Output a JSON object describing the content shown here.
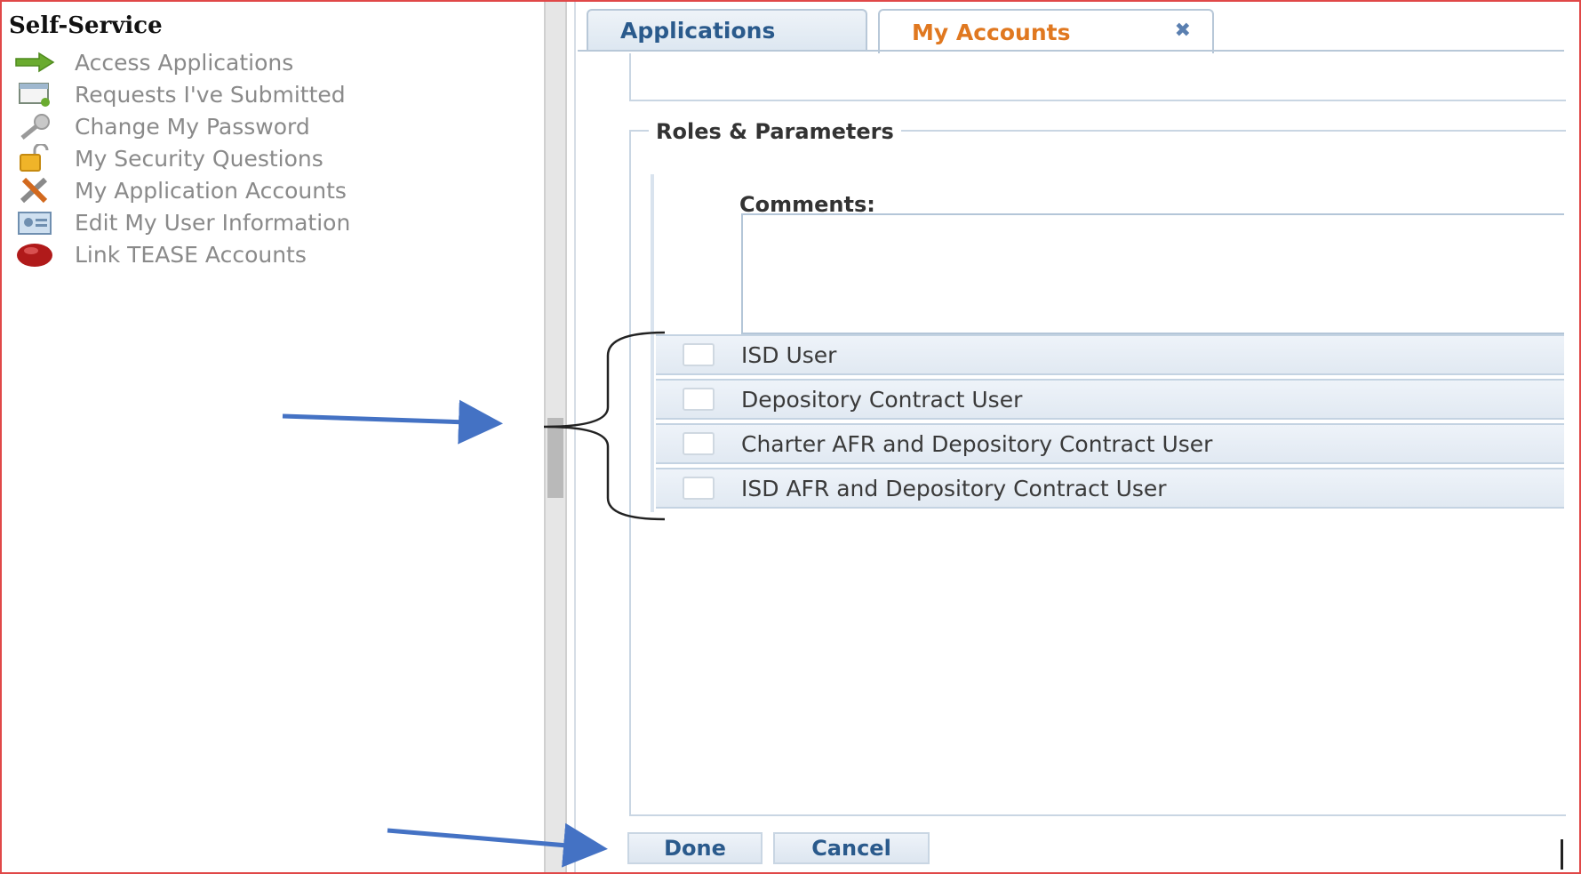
{
  "sidebar": {
    "title": "Self-Service",
    "items": [
      {
        "label": "Access Applications",
        "icon": "green-arrow-icon"
      },
      {
        "label": "Requests I've Submitted",
        "icon": "requests-icon"
      },
      {
        "label": "Change My Password",
        "icon": "key-icon"
      },
      {
        "label": "My Security Questions",
        "icon": "padlock-icon"
      },
      {
        "label": "My Application Accounts",
        "icon": "tools-icon"
      },
      {
        "label": "Edit My User Information",
        "icon": "user-card-icon"
      },
      {
        "label": "Link TEASE Accounts",
        "icon": "red-link-icon"
      }
    ]
  },
  "tabs": [
    {
      "label": "Applications",
      "active": false
    },
    {
      "label": "My Accounts",
      "active": true,
      "closable": true
    }
  ],
  "tab_close_symbol": "✖",
  "form": {
    "fieldset_legend": "Roles & Parameters",
    "comments_label": "Comments:",
    "comments_value": "",
    "roles": [
      {
        "label": "ISD User",
        "checked": false
      },
      {
        "label": "Depository Contract User",
        "checked": false
      },
      {
        "label": "Charter AFR and Depository Contract User",
        "checked": false
      },
      {
        "label": "ISD AFR and Depository Contract User",
        "checked": false
      }
    ]
  },
  "buttons": {
    "done": "Done",
    "cancel": "Cancel"
  },
  "colors": {
    "frame_border": "#e04848",
    "active_tab_text": "#e07820",
    "link_blue": "#2a5a8c",
    "annotation_arrow": "#4472c4"
  }
}
